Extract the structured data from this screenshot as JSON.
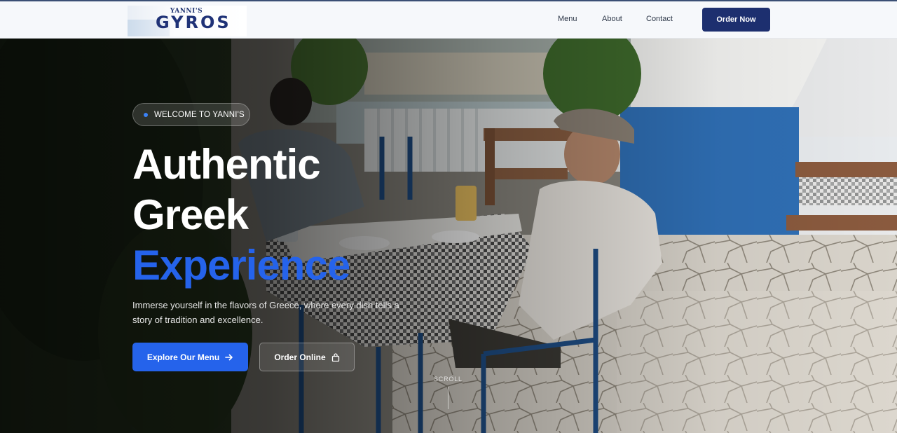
{
  "header": {
    "logo_small": "YANNI'S",
    "logo_big": "GYROS",
    "nav": [
      {
        "label": "Menu"
      },
      {
        "label": "About"
      },
      {
        "label": "Contact"
      }
    ],
    "order_button": "Order Now"
  },
  "hero": {
    "badge": "WELCOME TO YANNI'S",
    "title_line1": "Authentic",
    "title_line2": "Greek",
    "title_line3": "Experience",
    "description": "Immerse yourself in the flavors of Greece, where every dish tells a story of tradition and excellence.",
    "primary_button": "Explore Our Menu",
    "secondary_button": "Order Online",
    "scroll_label": "SCROLL"
  },
  "icons": {
    "arrow": "arrow-right-icon",
    "bag": "shopping-bag-icon"
  },
  "colors": {
    "brand_navy": "#1d2f6f",
    "accent_blue": "#2563eb",
    "header_bg": "#f6f8fb"
  }
}
